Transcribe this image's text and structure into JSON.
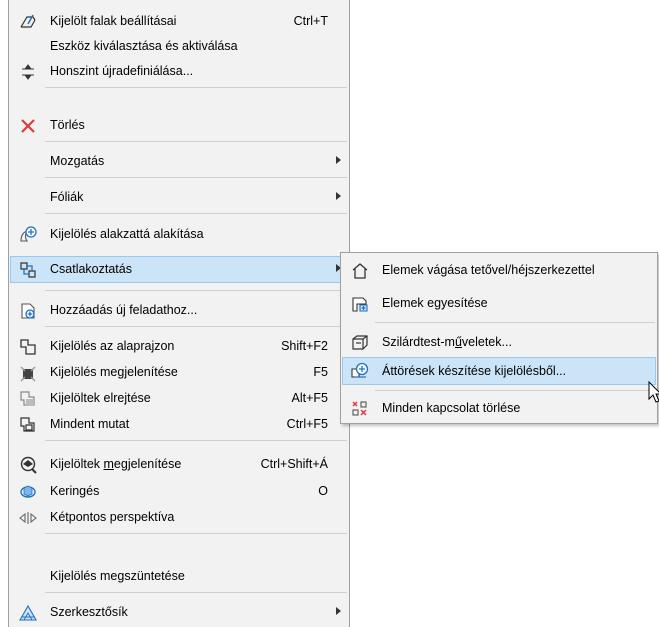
{
  "main_menu": {
    "items": [
      {
        "label": "Kijelölt falak beállításai",
        "shortcut": "Ctrl+T",
        "icon": "wall-settings-icon"
      },
      {
        "label": "Eszköz kiválasztása és aktiválása",
        "shortcut": "",
        "icon": ""
      },
      {
        "label": "Honszint újradefiniálása...",
        "shortcut": "",
        "icon": "home-story-icon"
      },
      {
        "label": "Törlés",
        "shortcut": "",
        "icon": "delete-icon"
      },
      {
        "label": "Mozgatás",
        "shortcut": "",
        "icon": "",
        "submenu": true
      },
      {
        "label": "Fóliák",
        "shortcut": "",
        "icon": "",
        "submenu": true
      },
      {
        "label": "Kijelölés alakzattá alakítása",
        "shortcut": "",
        "icon": "convert-to-morph-icon"
      },
      {
        "label": "Csatlakoztatás",
        "shortcut": "",
        "icon": "connect-icon",
        "submenu": true
      },
      {
        "label": "Hozzáadás új feladathoz...",
        "shortcut": "",
        "icon": "add-issue-icon"
      },
      {
        "label": "Kijelölés az alaprajzon",
        "shortcut": "Shift+F2",
        "icon": "select-floorplan-icon"
      },
      {
        "label": "Kijelölés megjelenítése",
        "shortcut": "F5",
        "icon": "show-selection-icon"
      },
      {
        "label": "Kijelöltek elrejtése",
        "shortcut": "Alt+F5",
        "icon": "hide-selected-icon"
      },
      {
        "label": "Mindent mutat",
        "shortcut": "Ctrl+F5",
        "icon": "show-all-icon"
      },
      {
        "label_pre": "Kijelöltek ",
        "label_u": "m",
        "label_post": "egjelenítése",
        "shortcut": "Ctrl+Shift+Á",
        "icon": "show-selected-3d-icon"
      },
      {
        "label": "Keringés",
        "shortcut": "O",
        "icon": "orbit-icon"
      },
      {
        "label": "Kétpontos perspektíva",
        "shortcut": "",
        "icon": "two-point-perspective-icon"
      },
      {
        "label": "Kijelölés megszüntetése",
        "shortcut": "",
        "icon": ""
      },
      {
        "label": "Szerkesztősík",
        "shortcut": "",
        "icon": "editing-plane-icon",
        "submenu": true
      }
    ]
  },
  "submenu": {
    "items": [
      {
        "label": "Elemek vágása tetővel/héjszerkezettel",
        "icon": "trim-to-roof-icon"
      },
      {
        "label": "Elemek egyesítése",
        "icon": "merge-elements-icon"
      },
      {
        "label_pre": "Szilárdtest-m",
        "label_u": "ű",
        "label_post": "veletek...",
        "icon": "solid-operations-icon"
      },
      {
        "label": "Áttörések készítése kijelölésből...",
        "icon": "create-openings-icon"
      },
      {
        "label": "Minden kapcsolat törlése",
        "icon": "delete-connections-icon"
      }
    ]
  },
  "colors": {
    "highlight": "#cce4f7",
    "highlight_border": "#99c9ef",
    "menu_bg": "#f2f2f2",
    "delete_red": "#e0393e",
    "icon_blue": "#1f6fc5"
  }
}
